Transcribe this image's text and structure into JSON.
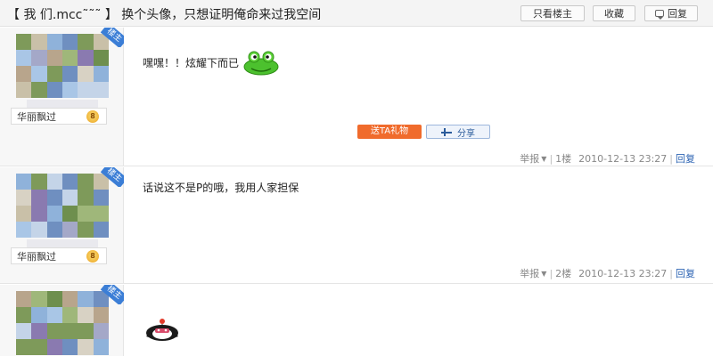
{
  "header": {
    "title": "【 我 们.mcc˜˜˜ 】 换个头像，只想证明俺命来过我空间",
    "buttons": {
      "host_only": "只看楼主",
      "favorite": "收藏",
      "reply": "回复"
    }
  },
  "badge": {
    "host": "楼主"
  },
  "posts": [
    {
      "username": "华丽飘过",
      "level": "8",
      "text": "嘿嘿！！炫耀下而已",
      "gift_button": "送TA礼物",
      "share_button": "分享",
      "footer": {
        "report": "举报",
        "floor": "1楼",
        "time": "2010-12-13 23:27",
        "reply": "回复"
      }
    },
    {
      "username": "华丽飘过",
      "level": "8",
      "text": "话说这不是P的哦，我用人家担保",
      "footer": {
        "report": "举报",
        "floor": "2楼",
        "time": "2010-12-13 23:27",
        "reply": "回复"
      }
    }
  ],
  "icons": {
    "frog": "frog-emoticon-icon",
    "penguin": "penguin-emoticon-icon",
    "share": "share-icon",
    "reply": "reply-icon",
    "level": "level-star-icon"
  },
  "colors": {
    "gift": "#f06b2c",
    "link": "#2d64b3",
    "host_badge": "#3b7ed6"
  }
}
